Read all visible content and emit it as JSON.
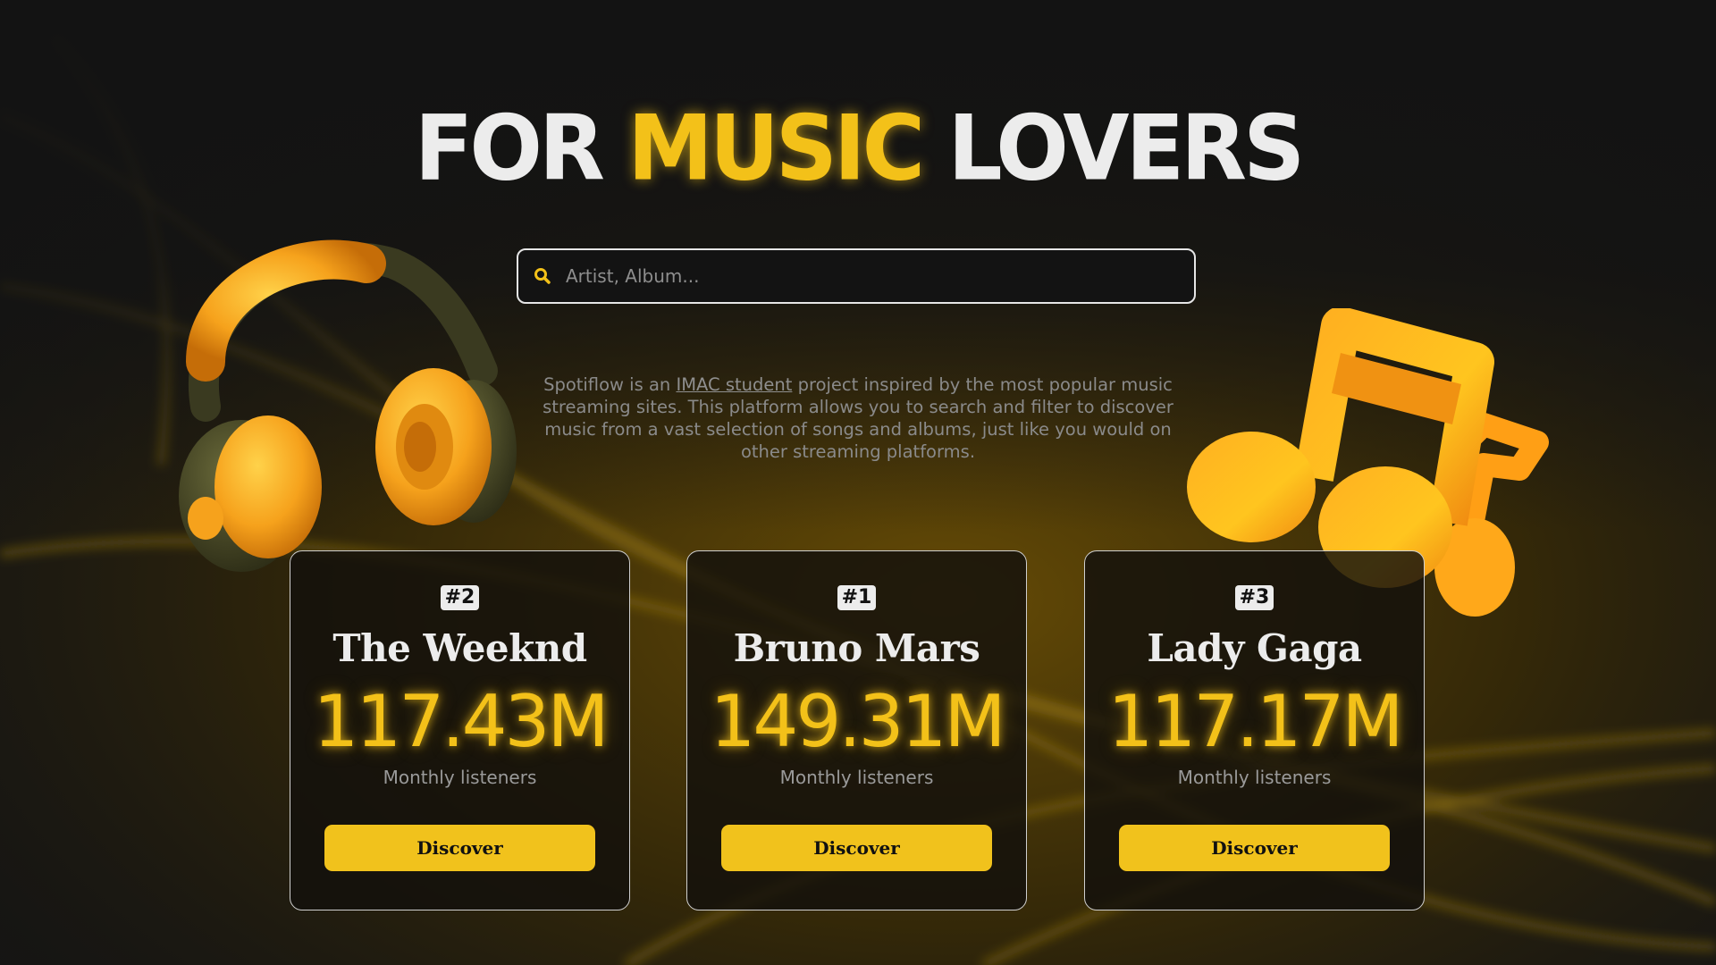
{
  "hero": {
    "title_part1": "FOR",
    "title_accent": "MUSIC",
    "title_part2": "LOVERS"
  },
  "search": {
    "placeholder": "Artist, Album...",
    "value": "",
    "icon": "search-icon"
  },
  "description": {
    "before_link": "Spotiflow is an",
    "link_text": "IMAC student",
    "after_link": "project inspired by the most popular music streaming sites. This platform allows you to search and filter to discover music from a vast selection of songs and albums, just like you would on other streaming platforms."
  },
  "cards": [
    {
      "rank": "#2",
      "artist": "The Weeknd",
      "listeners": "117.43M",
      "label": "Monthly listeners",
      "button": "Discover"
    },
    {
      "rank": "#1",
      "artist": "Bruno Mars",
      "listeners": "149.31M",
      "label": "Monthly listeners",
      "button": "Discover"
    },
    {
      "rank": "#3",
      "artist": "Lady Gaga",
      "listeners": "117.17M",
      "label": "Monthly listeners",
      "button": "Discover"
    }
  ],
  "decorations": {
    "left": "headphones-icon",
    "right": "music-note-icon"
  },
  "colors": {
    "accent": "#f3c119",
    "background": "#141414",
    "text": "#ececec",
    "muted": "#8a8a8a"
  }
}
